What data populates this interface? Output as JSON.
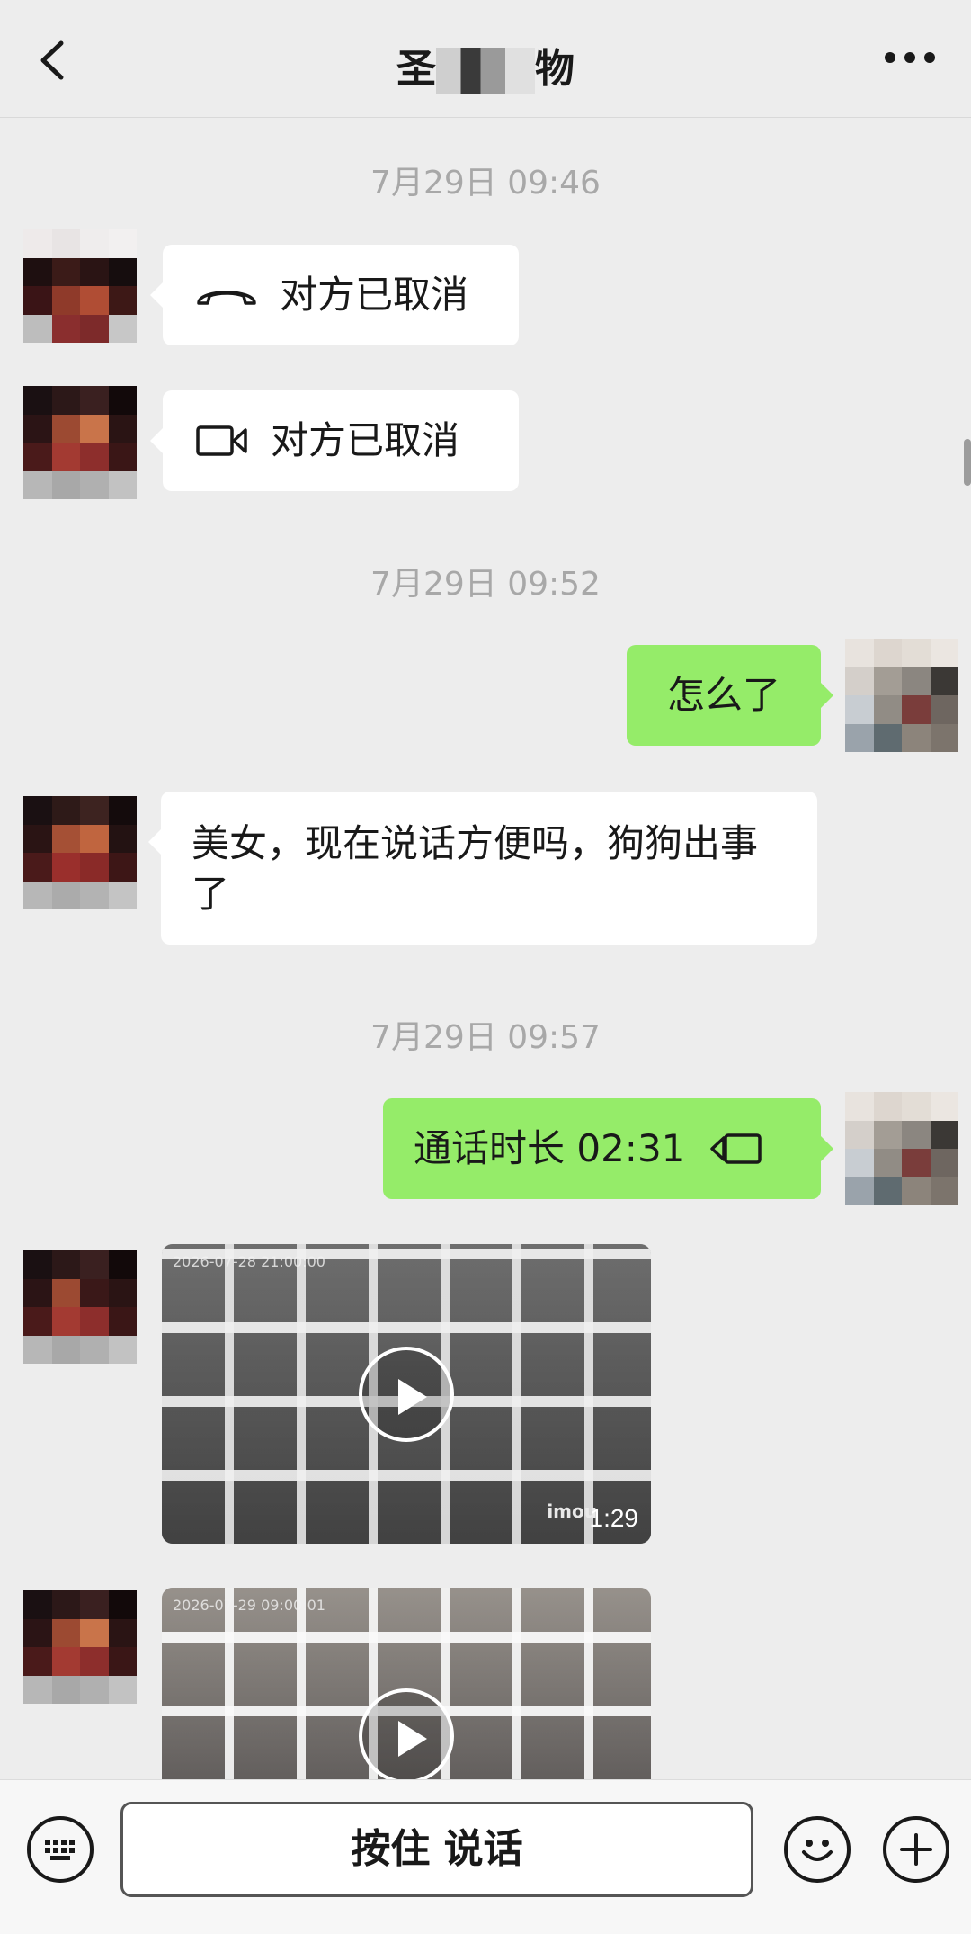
{
  "header": {
    "title_prefix": "圣",
    "title_suffix": "物"
  },
  "messages": {
    "time1": "7月29日 09:46",
    "call_voice": {
      "label": "对方已取消",
      "icon": "phone-icon"
    },
    "call_video": {
      "label": "对方已取消",
      "icon": "video-camera-icon"
    },
    "time2": "7月29日 09:52",
    "sent1": "怎么了",
    "recv1": "美女，现在说话方便吗，狗狗出事了",
    "time3": "7月29日 09:57",
    "sent_call": {
      "label": "通话时长 02:31",
      "icon": "video-camera-icon"
    },
    "video1": {
      "duration": "1:29",
      "watermark": "imou",
      "timestamp": "2026-07-28 21:00:00"
    },
    "video2": {
      "timestamp": "2026-07-29 09:00:01"
    }
  },
  "bottom_bar": {
    "voice_label": "按住 说话",
    "icons": [
      "keyboard-icon",
      "emoji-icon",
      "plus-icon"
    ]
  },
  "colors": {
    "background": "#ededed",
    "sent_bubble": "#95ec69",
    "received_bubble": "#ffffff",
    "time_text": "#a8a8a8"
  }
}
